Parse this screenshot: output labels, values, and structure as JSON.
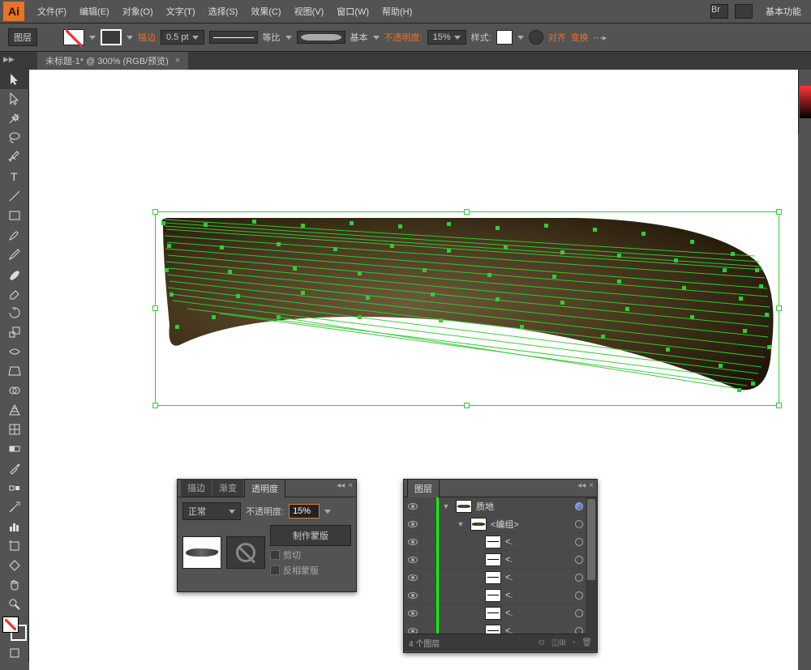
{
  "menu": [
    "文件(F)",
    "编辑(E)",
    "对象(O)",
    "文字(T)",
    "选择(S)",
    "效果(C)",
    "视图(V)",
    "窗口(W)",
    "帮助(H)"
  ],
  "workspace": "基本功能",
  "options": {
    "layer_label": "图层",
    "stroke_label": "描边",
    "stroke_weight": "0.5 pt",
    "proportional": "等比",
    "basic": "基本",
    "opacity_label": "不透明度:",
    "opacity_value": "15%",
    "style_label": "样式:",
    "align_label": "对齐",
    "transform_label": "变换"
  },
  "tab": {
    "title": "未标题-1* @ 300% (RGB/预览)"
  },
  "transparency_panel": {
    "tabs": [
      "描边",
      "渐变",
      "透明度"
    ],
    "blend_mode": "正常",
    "opacity_label": "不透明度:",
    "opacity_value": "15%",
    "make_mask": "制作蒙版",
    "clip": "剪切",
    "invert": "反相蒙版"
  },
  "layers_panel": {
    "tab": "图层",
    "rows": [
      {
        "type": "top",
        "name": "质地",
        "expanded": true,
        "selected": true
      },
      {
        "type": "group",
        "name": "<编组>",
        "expanded": true,
        "selected": true
      },
      {
        "type": "item",
        "name": "<.",
        "selected": true
      },
      {
        "type": "item",
        "name": "<.",
        "selected": true
      },
      {
        "type": "item",
        "name": "<.",
        "selected": true
      },
      {
        "type": "item",
        "name": "<.",
        "selected": true
      },
      {
        "type": "item",
        "name": "<.",
        "selected": true
      },
      {
        "type": "item",
        "name": "<.",
        "selected": true
      },
      {
        "type": "item",
        "name": "<.",
        "selected": true
      }
    ],
    "footer": "4 个图层"
  }
}
